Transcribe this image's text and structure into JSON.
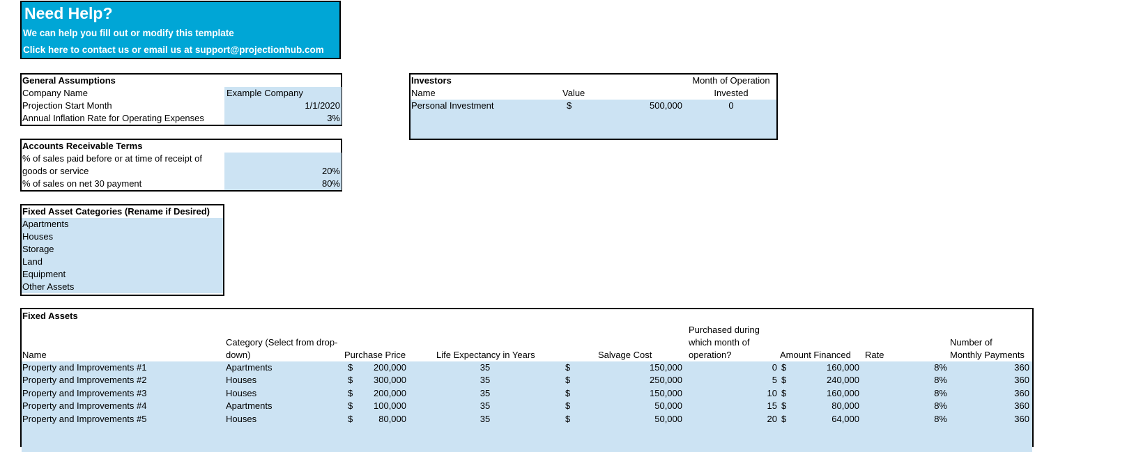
{
  "help": {
    "title": "Need Help?",
    "line1": "We can help you fill out or modify this template",
    "line2": "Click here to contact us or email us at support@projectionhub.com"
  },
  "general": {
    "title": "General Assumptions",
    "rows": [
      {
        "label": "Company Name",
        "value": "Example Company"
      },
      {
        "label": "Projection Start Month",
        "value": "1/1/2020"
      },
      {
        "label": "Annual Inflation Rate for Operating Expenses",
        "value": "3%"
      }
    ]
  },
  "investors": {
    "title": "Investors",
    "col_name": "Name",
    "col_value": "Value",
    "col_month_line1": "Month of Operation",
    "col_month_line2": "Invested",
    "rows": [
      {
        "name": "Personal Investment",
        "currency": "$",
        "value": "500,000",
        "month": "0"
      }
    ]
  },
  "ar": {
    "title": "Accounts Receivable Terms",
    "row1_label_line1": "% of sales paid before or at time of receipt of",
    "row1_label_line2": "goods or service",
    "row1_value": "20%",
    "row2_label": "% of sales on net 30 payment",
    "row2_value": "80%"
  },
  "categories": {
    "title": "Fixed Asset Categories (Rename if Desired)",
    "items": [
      "Apartments",
      "Houses",
      "Storage",
      "Land",
      "Equipment",
      "Other Assets"
    ]
  },
  "fixed_assets": {
    "title": "Fixed Assets",
    "headers": {
      "name": "Name",
      "category_line1": "Category (Select from drop-",
      "category_line2": "down)",
      "purchase_price": "Purchase Price",
      "life": "Life Expectancy in Years",
      "salvage": "Salvage Cost",
      "month_line1": "Purchased during",
      "month_line2": "which month of",
      "month_line3": "operation?",
      "financed": "Amount Financed",
      "rate": "Rate",
      "payments_line1": "Number of",
      "payments_line2": "Monthly Payments"
    },
    "currency": "$",
    "rows": [
      {
        "name": "Property and Improvements #1",
        "category": "Apartments",
        "price": "200,000",
        "life": "35",
        "salvage": "150,000",
        "month": "0",
        "financed": "160,000",
        "rate": "8%",
        "payments": "360"
      },
      {
        "name": "Property and Improvements #2",
        "category": "Houses",
        "price": "300,000",
        "life": "35",
        "salvage": "250,000",
        "month": "5",
        "financed": "240,000",
        "rate": "8%",
        "payments": "360"
      },
      {
        "name": "Property and Improvements #3",
        "category": "Houses",
        "price": "200,000",
        "life": "35",
        "salvage": "150,000",
        "month": "10",
        "financed": "160,000",
        "rate": "8%",
        "payments": "360"
      },
      {
        "name": "Property and Improvements #4",
        "category": "Apartments",
        "price": "100,000",
        "life": "35",
        "salvage": "50,000",
        "month": "15",
        "financed": "80,000",
        "rate": "8%",
        "payments": "360"
      },
      {
        "name": "Property and Improvements #5",
        "category": "Houses",
        "price": "80,000",
        "life": "35",
        "salvage": "50,000",
        "month": "20",
        "financed": "64,000",
        "rate": "8%",
        "payments": "360"
      }
    ]
  }
}
